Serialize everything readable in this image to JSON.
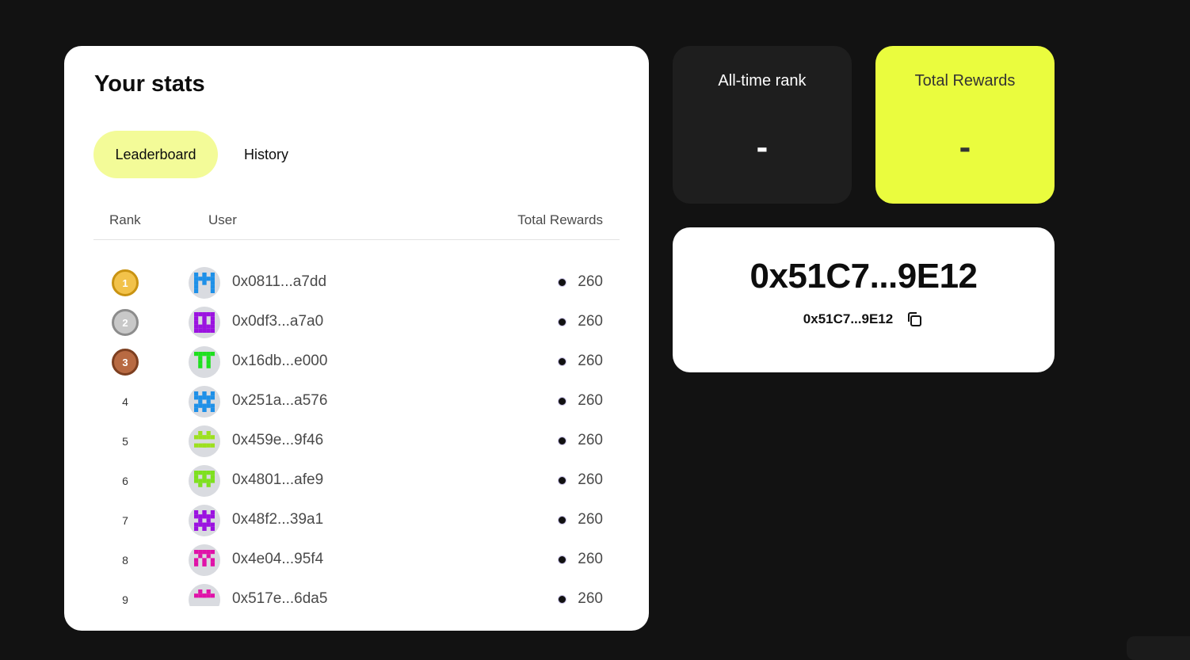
{
  "stats": {
    "title": "Your stats",
    "tabs": [
      {
        "label": "Leaderboard",
        "active": true
      },
      {
        "label": "History",
        "active": false
      }
    ],
    "columns": {
      "rank": "Rank",
      "user": "User",
      "rewards": "Total Rewards"
    },
    "rows": [
      {
        "rank": "1",
        "medal": "gold",
        "address": "0x0811...a7dd",
        "reward": "260",
        "avatar_color": "#1e90e8"
      },
      {
        "rank": "2",
        "medal": "silver",
        "address": "0x0df3...a7a0",
        "reward": "260",
        "avatar_color": "#9b12e0"
      },
      {
        "rank": "3",
        "medal": "bronze",
        "address": "0x16db...e000",
        "reward": "260",
        "avatar_color": "#1ee01e"
      },
      {
        "rank": "4",
        "medal": "",
        "address": "0x251a...a576",
        "reward": "260",
        "avatar_color": "#1e90e8"
      },
      {
        "rank": "5",
        "medal": "",
        "address": "0x459e...9f46",
        "reward": "260",
        "avatar_color": "#9ce01e"
      },
      {
        "rank": "6",
        "medal": "",
        "address": "0x4801...afe9",
        "reward": "260",
        "avatar_color": "#7ee01e"
      },
      {
        "rank": "7",
        "medal": "",
        "address": "0x48f2...39a1",
        "reward": "260",
        "avatar_color": "#9b12e0"
      },
      {
        "rank": "8",
        "medal": "",
        "address": "0x4e04...95f4",
        "reward": "260",
        "avatar_color": "#e012a8"
      },
      {
        "rank": "9",
        "medal": "",
        "address": "0x517e...6da5",
        "reward": "260",
        "avatar_color": "#e012a8"
      }
    ]
  },
  "tiles": {
    "rank": {
      "label": "All-time rank",
      "value": "-"
    },
    "rewards": {
      "label": "Total Rewards",
      "value": "-"
    }
  },
  "address_card": {
    "address_large": "0x51C7...9E12",
    "address_small": "0x51C7...9E12"
  },
  "colors": {
    "background": "#121212",
    "accent_yellow": "#eafc3e",
    "tab_active": "#f3fb98",
    "dark_tile": "#1e1e1e"
  }
}
